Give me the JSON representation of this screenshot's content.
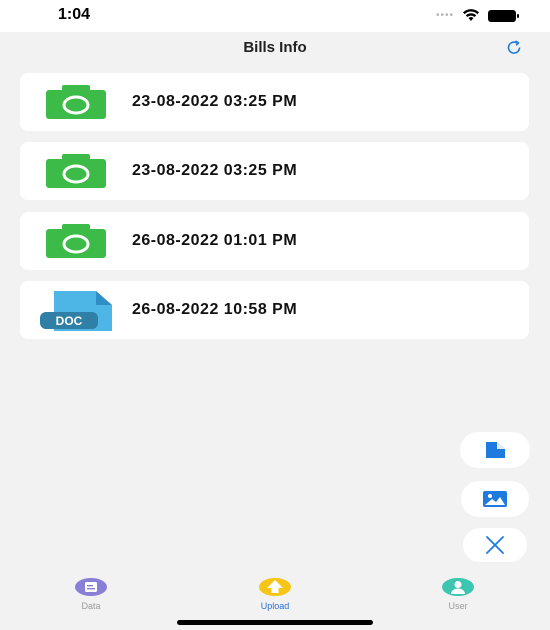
{
  "status_bar": {
    "time": "1:04"
  },
  "header": {
    "title": "Bills Info"
  },
  "bills": [
    {
      "date": "23-08-2022 03:25 PM",
      "icon": "camera-icon"
    },
    {
      "date": "23-08-2022 03:25 PM",
      "icon": "camera-icon"
    },
    {
      "date": "26-08-2022 01:01 PM",
      "icon": "camera-icon"
    },
    {
      "date": "26-08-2022 10:58 PM",
      "icon": "doc-file-icon",
      "icon_label": "DOC"
    }
  ],
  "fab_actions": [
    "document-icon",
    "image-icon",
    "close-icon"
  ],
  "tabs": [
    {
      "label": "Data",
      "active": false
    },
    {
      "label": "Upload",
      "active": true
    },
    {
      "label": "User",
      "active": false
    }
  ],
  "colors": {
    "camera_green": "#3dbb49",
    "accent_blue": "#1f7ae0",
    "doc_blue": "#4db6e6",
    "doc_label_bg": "#2f7fa6",
    "tab_active": "#2b6fd6"
  }
}
